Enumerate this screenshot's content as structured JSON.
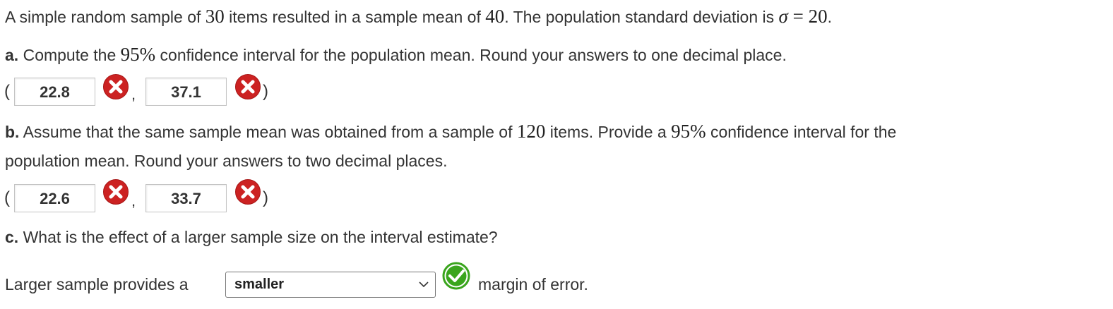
{
  "intro": {
    "p1": "A simple random sample of ",
    "n": "30",
    "p2": " items resulted in a sample mean of ",
    "mean": "40",
    "p3": ". The population standard deviation is ",
    "sigma": "σ",
    "eq": " = ",
    "sd": "20",
    "p4": "."
  },
  "part_a": {
    "label": "a.",
    "p1": " Compute the ",
    "conf": "95%",
    "p2": " confidence interval for the population mean. Round your answers to one decimal place.",
    "open": "(",
    "comma": ",",
    "close": ")",
    "lower": "22.8",
    "upper": "37.1",
    "lower_status": "incorrect-icon",
    "upper_status": "incorrect-icon"
  },
  "part_b": {
    "label": "b.",
    "p1": " Assume that the same sample mean was obtained from a sample of ",
    "n": "120",
    "p2": " items. Provide a ",
    "conf": "95%",
    "p3": " confidence interval for the",
    "line2": "population mean. Round your answers to two decimal places.",
    "open": "(",
    "comma": ",",
    "close": ")",
    "lower": "22.6",
    "upper": "33.7",
    "lower_status": "incorrect-icon",
    "upper_status": "incorrect-icon"
  },
  "part_c": {
    "label": "c.",
    "question": " What is the effect of a larger sample size on the interval estimate?",
    "prefix": "Larger sample provides a",
    "selected": "smaller",
    "suffix": "margin of error.",
    "status": "correct-icon"
  },
  "colors": {
    "incorrect": "#cc2222",
    "correct": "#3aa51d"
  }
}
